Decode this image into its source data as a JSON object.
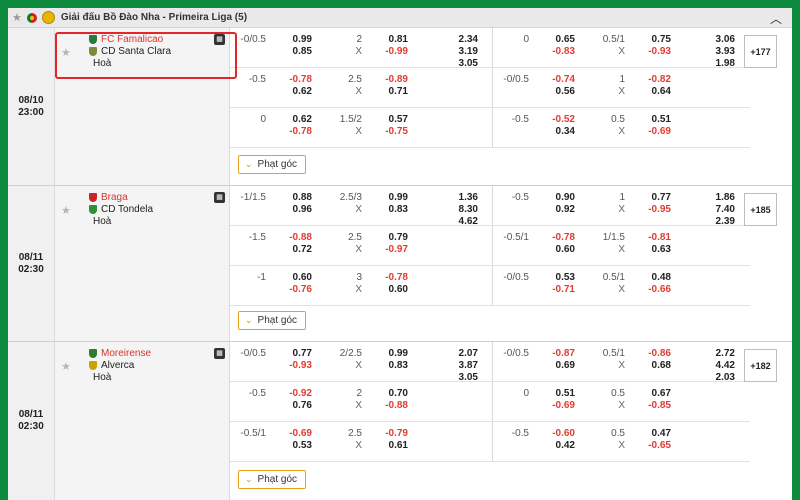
{
  "league": {
    "title": "Giải đấu Bồ Đào Nha - Primeira Liga (5)",
    "star_icon": "star-icon",
    "collapse_icon": "chevron-up-icon"
  },
  "corner_label": "Phạt góc",
  "matches": [
    {
      "date": "08/10",
      "time": "23:00",
      "home": "FC Famalicao",
      "away": "CD Santa Clara",
      "draw": "Hoà",
      "more": "+177",
      "rows": [
        {
          "ft": {
            "h": "-0/0.5",
            "h1": "0.99",
            "h2": "0.85",
            "t": "2",
            "tx": "X",
            "o1": "0.81",
            "o2": "-0.99",
            "m1": "2.34",
            "m2": "3.19",
            "m3": "3.05"
          },
          "h1": {
            "h": "0",
            "h1": "0.65",
            "h2": "-0.83",
            "t": "0.5/1",
            "tx": "X",
            "o1": "0.75",
            "o2": "-0.93",
            "m1": "3.06",
            "m2": "3.93",
            "m3": "1.98"
          }
        },
        {
          "ft": {
            "h": "-0.5",
            "h1": "-0.78",
            "h2": "0.62",
            "t": "2.5",
            "tx": "X",
            "o1": "-0.89",
            "o2": "0.71"
          },
          "h1": {
            "h": "-0/0.5",
            "h1": "-0.74",
            "h2": "0.56",
            "t": "1",
            "tx": "X",
            "o1": "-0.82",
            "o2": "0.64"
          }
        },
        {
          "ft": {
            "h": "0",
            "h1": "0.62",
            "h2": "-0.78",
            "t": "1.5/2",
            "tx": "X",
            "o1": "0.57",
            "o2": "-0.75"
          },
          "h1": {
            "h": "-0.5",
            "h1": "-0.52",
            "h2": "0.34",
            "t": "0.5",
            "tx": "X",
            "o1": "0.51",
            "o2": "-0.69"
          }
        }
      ]
    },
    {
      "date": "08/11",
      "time": "02:30",
      "home": "Braga",
      "away": "CD Tondela",
      "draw": "Hoà",
      "more": "+185",
      "rows": [
        {
          "ft": {
            "h": "-1/1.5",
            "h1": "0.88",
            "h2": "0.96",
            "t": "2.5/3",
            "tx": "X",
            "o1": "0.99",
            "o2": "0.83",
            "m1": "1.36",
            "m2": "8.30",
            "m3": "4.62"
          },
          "h1": {
            "h": "-0.5",
            "h1": "0.90",
            "h2": "0.92",
            "t": "1",
            "tx": "X",
            "o1": "0.77",
            "o2": "-0.95",
            "m1": "1.86",
            "m2": "7.40",
            "m3": "2.39"
          }
        },
        {
          "ft": {
            "h": "-1.5",
            "h1": "-0.88",
            "h2": "0.72",
            "t": "2.5",
            "tx": "X",
            "o1": "0.79",
            "o2": "-0.97"
          },
          "h1": {
            "h": "-0.5/1",
            "h1": "-0.78",
            "h2": "0.60",
            "t": "1/1.5",
            "tx": "X",
            "o1": "-0.81",
            "o2": "0.63"
          }
        },
        {
          "ft": {
            "h": "-1",
            "h1": "0.60",
            "h2": "-0.76",
            "t": "3",
            "tx": "X",
            "o1": "-0.78",
            "o2": "0.60"
          },
          "h1": {
            "h": "-0/0.5",
            "h1": "0.53",
            "h2": "-0.71",
            "t": "0.5/1",
            "tx": "X",
            "o1": "0.48",
            "o2": "-0.66"
          }
        }
      ]
    },
    {
      "date": "08/11",
      "time": "02:30",
      "home": "Moreirense",
      "away": "Alverca",
      "draw": "Hoà",
      "more": "+182",
      "rows": [
        {
          "ft": {
            "h": "-0/0.5",
            "h1": "0.77",
            "h2": "-0.93",
            "t": "2/2.5",
            "tx": "X",
            "o1": "0.99",
            "o2": "0.83",
            "m1": "2.07",
            "m2": "3.87",
            "m3": "3.05"
          },
          "h1": {
            "h": "-0/0.5",
            "h1": "-0.87",
            "h2": "0.69",
            "t": "0.5/1",
            "tx": "X",
            "o1": "-0.86",
            "o2": "0.68",
            "m1": "2.72",
            "m2": "4.42",
            "m3": "2.03"
          }
        },
        {
          "ft": {
            "h": "-0.5",
            "h1": "-0.92",
            "h2": "0.76",
            "t": "2",
            "tx": "X",
            "o1": "0.70",
            "o2": "-0.88"
          },
          "h1": {
            "h": "0",
            "h1": "0.51",
            "h2": "-0.69",
            "t": "0.5",
            "tx": "X",
            "o1": "0.67",
            "o2": "-0.85"
          }
        },
        {
          "ft": {
            "h": "-0.5/1",
            "h1": "-0.69",
            "h2": "0.53",
            "t": "2.5",
            "tx": "X",
            "o1": "-0.79",
            "o2": "0.61"
          },
          "h1": {
            "h": "-0.5",
            "h1": "-0.60",
            "h2": "0.42",
            "t": "0.5",
            "tx": "X",
            "o1": "0.47",
            "o2": "-0.65"
          }
        }
      ]
    }
  ],
  "colors": {
    "accent_green": "#0e8a3e",
    "negative": "#e03c31",
    "home_team": "#d9352f",
    "highlight": "#e3262b",
    "corner_border": "#e8a21a"
  }
}
